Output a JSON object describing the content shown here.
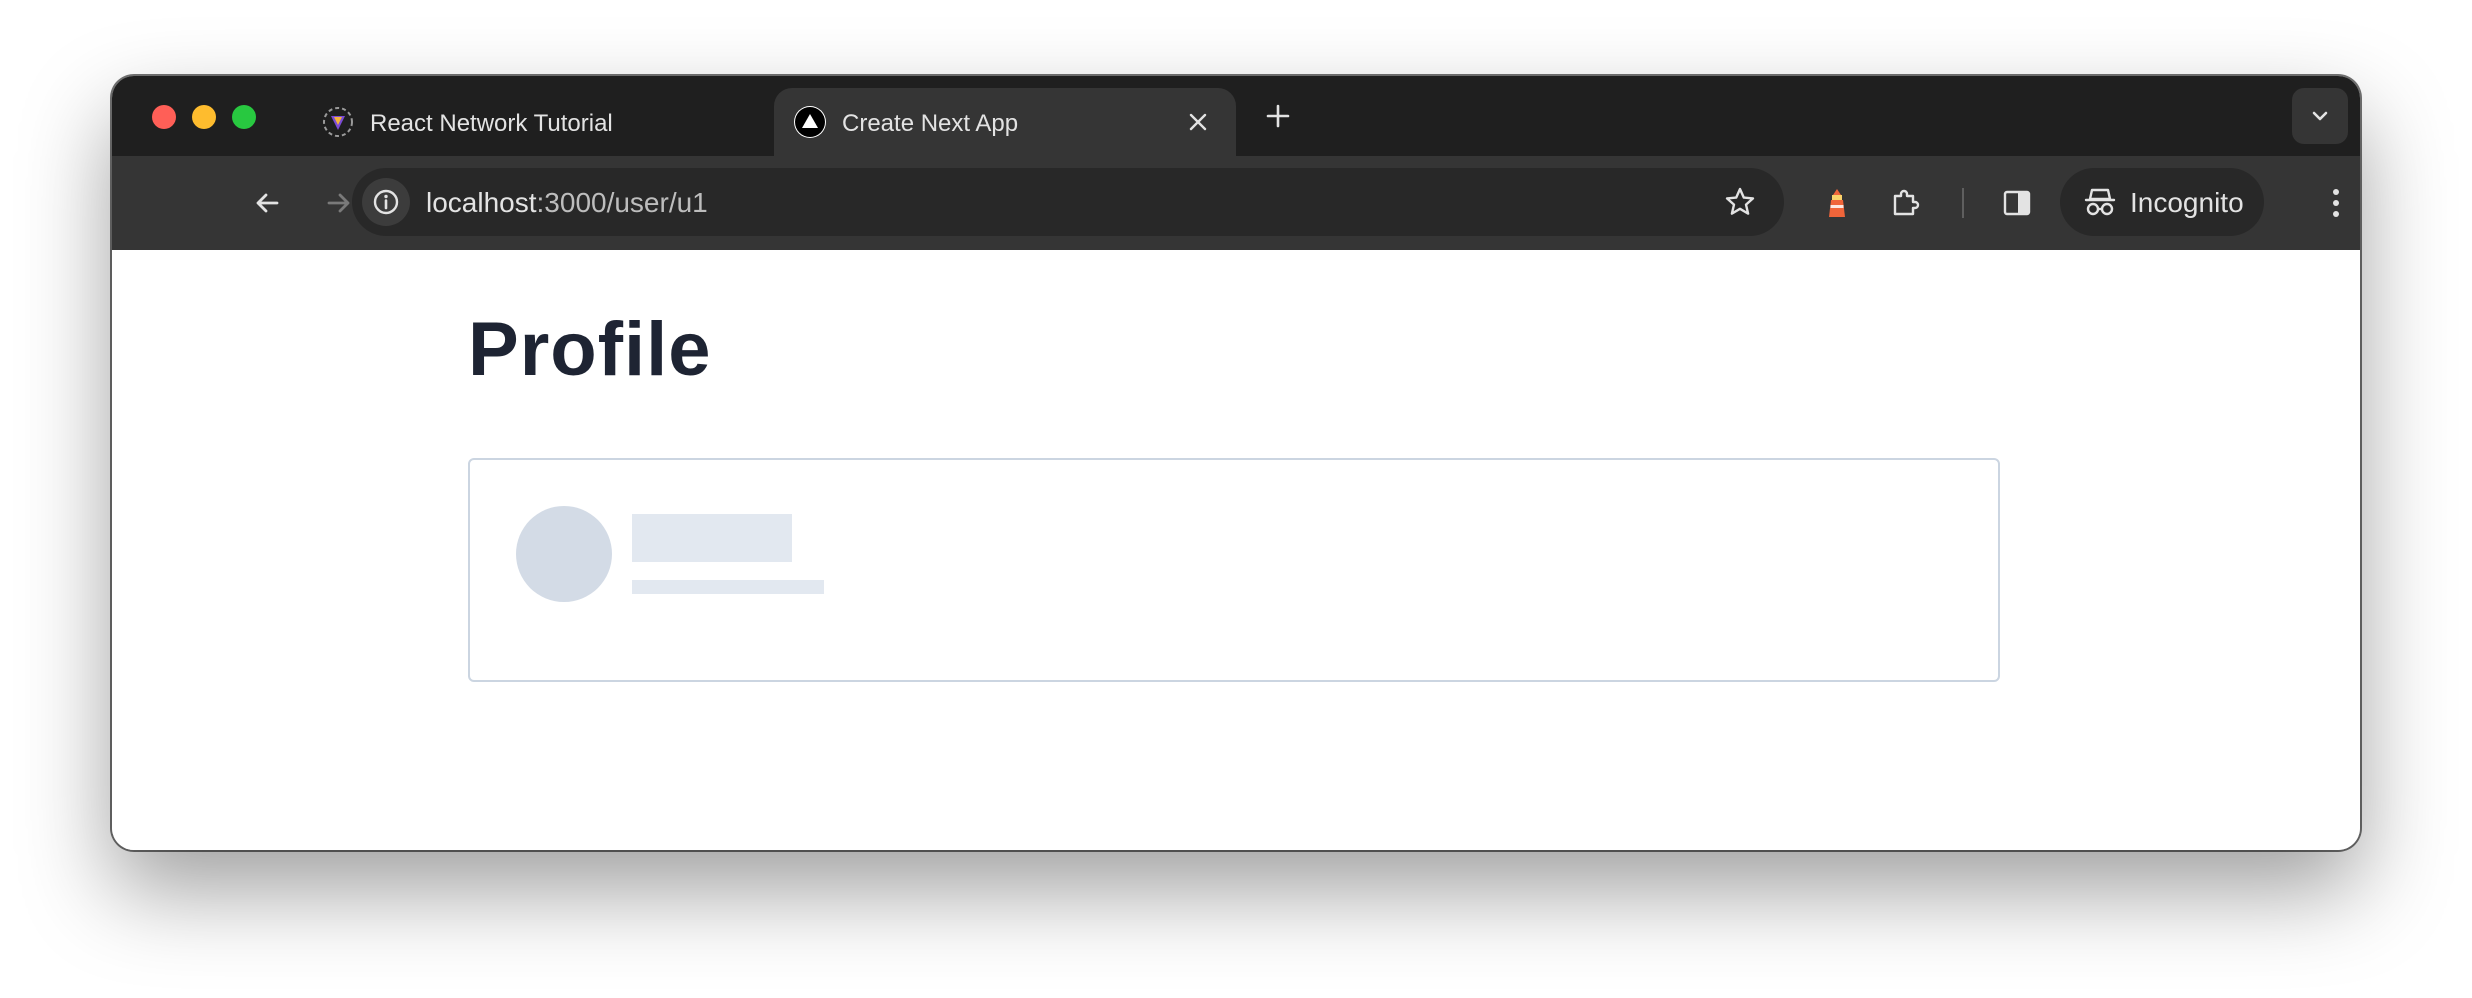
{
  "browser": {
    "tabs": [
      {
        "title": "React Network Tutorial",
        "active": false,
        "favicon": "react-network-favicon-icon"
      },
      {
        "title": "Create Next App",
        "active": true,
        "favicon": "nextjs-triangle-icon"
      }
    ],
    "address": {
      "host": "localhost",
      "path": ":3000/user/u1"
    },
    "incognito_label": "Incognito"
  },
  "page": {
    "title": "Profile",
    "card_state": "loading-skeleton"
  },
  "colors": {
    "titlebar": "#1f1f1f",
    "toolbar": "#353535",
    "page_title": "#1e2433",
    "card_border": "#cbd5e1",
    "skeleton": "#e2e8f0",
    "skeleton_avatar": "#d3dbe6"
  }
}
